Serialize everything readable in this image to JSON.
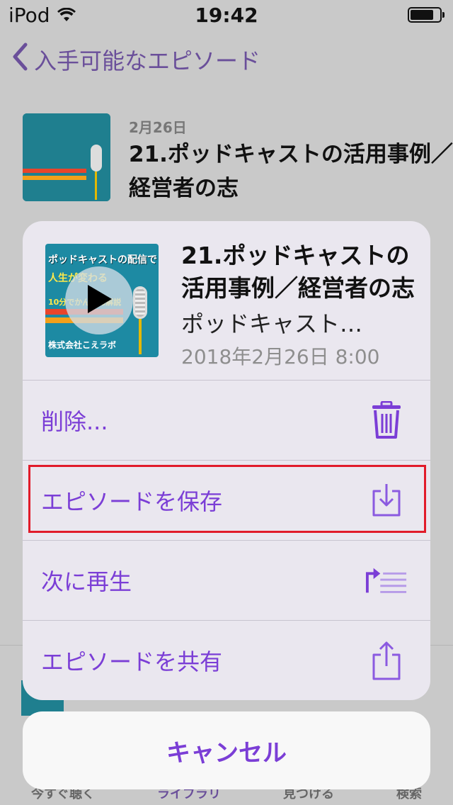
{
  "status_bar": {
    "carrier": "iPod",
    "time": "19:42",
    "icons": [
      "wifi-icon",
      "battery-icon"
    ]
  },
  "nav": {
    "back_label": "入手可能なエピソード"
  },
  "background_episode": {
    "date": "2月26日",
    "title": "21.ポッドキャストの活用事例／経営者の志"
  },
  "background_tabbar": {
    "tabs": [
      "今すぐ聴く",
      "ライブラリ",
      "見つける",
      "検索"
    ],
    "active_tab": "ライブラリ"
  },
  "artwork": {
    "line1": "ポッドキャストの配信で",
    "line2": "人生が変わる",
    "line3": "10分でかんたん解説",
    "line4": "株式会社こえラボ"
  },
  "sheet": {
    "title": "21.ポッドキャストの活用事例／経営者の志",
    "podcast": "ポッドキャスト…",
    "datetime": "2018年2月26日 8:00",
    "actions": [
      {
        "label": "削除...",
        "icon": "trash-icon"
      },
      {
        "label": "エピソードを保存",
        "icon": "download-icon"
      },
      {
        "label": "次に再生",
        "icon": "play-next-icon"
      },
      {
        "label": "エピソードを共有",
        "icon": "share-icon"
      }
    ],
    "cancel_label": "キャンセル"
  },
  "colors": {
    "accent": "#7b3ed6",
    "highlight": "#e11b2a",
    "sheet_background": "#eae7ef"
  }
}
